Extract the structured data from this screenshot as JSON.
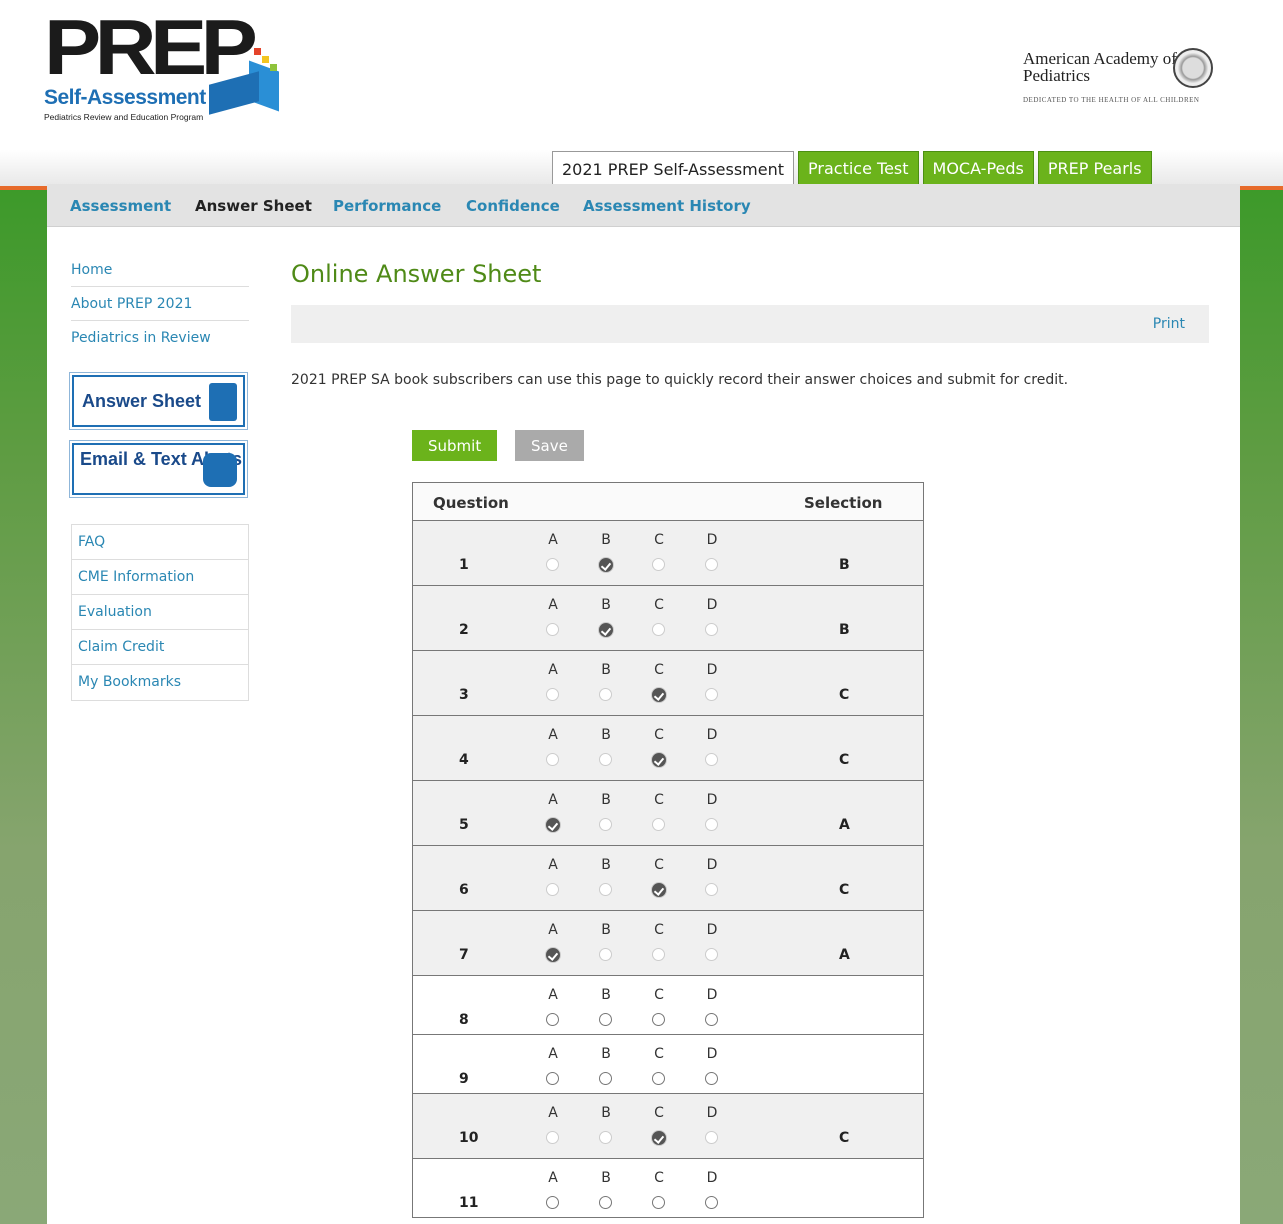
{
  "header": {
    "logo_main": "PREP",
    "logo_sub": "Self-Assessment",
    "logo_tag": "Pediatrics Review and Education Program",
    "org_name": "American Academy of Pediatrics",
    "org_tag": "DEDICATED TO THE HEALTH OF ALL CHILDREN"
  },
  "tabs": [
    {
      "label": "2021 PREP Self-Assessment",
      "active": true
    },
    {
      "label": "Practice Test"
    },
    {
      "label": "MOCA-Peds"
    },
    {
      "label": "PREP Pearls"
    }
  ],
  "subnav": [
    "Assessment",
    "Answer Sheet",
    "Performance",
    "Confidence",
    "Assessment History"
  ],
  "sidebar": {
    "links": [
      "Home",
      "About PREP 2021",
      "Pediatrics in Review"
    ],
    "promo_answer_sheet": "Answer Sheet",
    "promo_alerts": "Email & Text Alerts",
    "box_links": [
      "FAQ",
      "CME Information",
      "Evaluation",
      "Claim Credit",
      "My Bookmarks"
    ]
  },
  "main": {
    "title": "Online Answer Sheet",
    "print": "Print",
    "intro": "2021 PREP SA book subscribers can use this page to quickly record their answer choices and submit for credit.",
    "submit": "Submit",
    "save": "Save",
    "col_question": "Question",
    "col_selection": "Selection",
    "options": [
      "A",
      "B",
      "C",
      "D"
    ],
    "rows": [
      {
        "q": "1",
        "sel": "B"
      },
      {
        "q": "2",
        "sel": "B"
      },
      {
        "q": "3",
        "sel": "C"
      },
      {
        "q": "4",
        "sel": "C"
      },
      {
        "q": "5",
        "sel": "A"
      },
      {
        "q": "6",
        "sel": "C"
      },
      {
        "q": "7",
        "sel": "A"
      },
      {
        "q": "8",
        "sel": ""
      },
      {
        "q": "9",
        "sel": ""
      },
      {
        "q": "10",
        "sel": "C"
      },
      {
        "q": "11",
        "sel": ""
      }
    ]
  }
}
